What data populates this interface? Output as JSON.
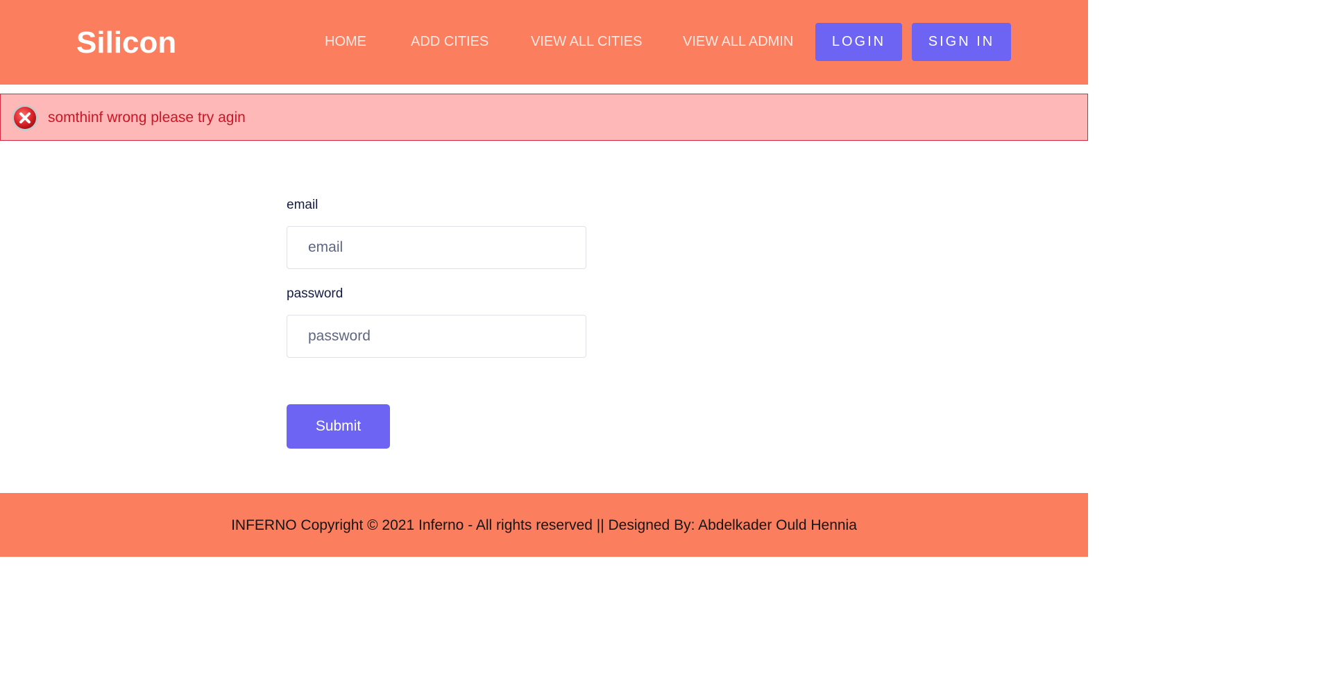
{
  "navbar": {
    "brand": "Silicon",
    "links": [
      "HOME",
      "ADD CITIES",
      "VIEW ALL CITIES",
      "VIEW ALL ADMIN"
    ],
    "login_label": "LOGIN",
    "signin_label": "SIGN IN"
  },
  "alert": {
    "icon": "error-circle-icon",
    "message": "somthinf wrong please try agin"
  },
  "form": {
    "email_label": "email",
    "email_placeholder": "email",
    "password_label": "password",
    "password_placeholder": "password",
    "submit_label": "Submit"
  },
  "footer": {
    "text": "INFERNO Copyright © 2021 Inferno - All rights reserved || Designed By: Abdelkader Ould Hennia"
  },
  "colors": {
    "header_bg": "#fb7f5f",
    "button_bg": "#6d64f3",
    "alert_bg": "#ffb8b8",
    "alert_text": "#cf1426"
  }
}
